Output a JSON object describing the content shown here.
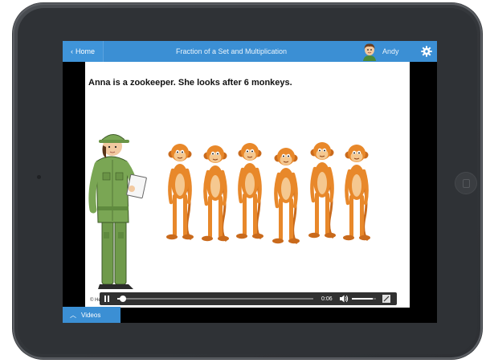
{
  "topbar": {
    "home_label": "Home",
    "title": "Fraction of a Set and Multiplication",
    "user_name": "Andy",
    "accent_color": "#3b8fd4"
  },
  "video": {
    "caption": "Anna is a zookeeper.  She looks after 6 monkeys.",
    "copyright": "© He",
    "time_display": "0:06",
    "progress_fraction": 0.02,
    "volume_fraction": 0.85
  },
  "bottom": {
    "videos_label": "Videos"
  },
  "icons": [
    "chevron-left-icon",
    "avatar-icon",
    "gear-icon",
    "pause-icon",
    "volume-icon",
    "fullscreen-icon",
    "chevron-up-icon"
  ]
}
